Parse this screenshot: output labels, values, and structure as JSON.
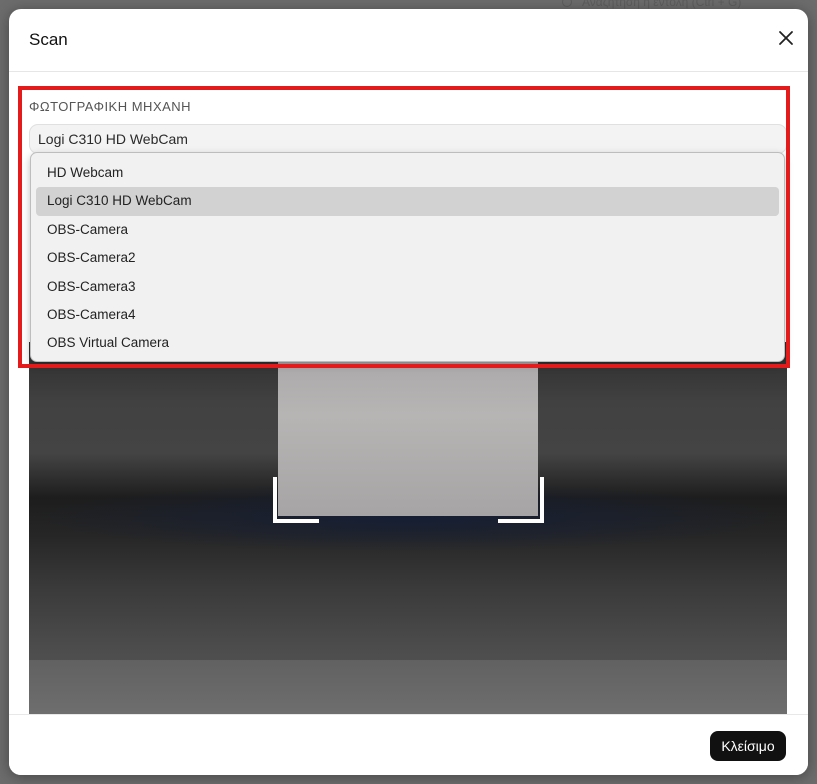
{
  "background": {
    "search_text": "Αναζήτηση ή εντολή (Ctrl + G)"
  },
  "modal": {
    "title": "Scan",
    "close_icon": "close-icon",
    "camera": {
      "label": "ΦΩΤΟΓΡΑΦΙΚΗ ΜΗΧΑΝΗ",
      "selected": "Logi C310 HD WebCam",
      "options": [
        "HD Webcam",
        "Logi C310 HD WebCam",
        "OBS-Camera",
        "OBS-Camera2",
        "OBS-Camera3",
        "OBS-Camera4",
        "OBS Virtual Camera"
      ],
      "selected_index": 1
    },
    "footer": {
      "close_label": "Κλείσιμο"
    }
  },
  "colors": {
    "highlight": "#e31b1b",
    "primary_button": "#111111"
  }
}
